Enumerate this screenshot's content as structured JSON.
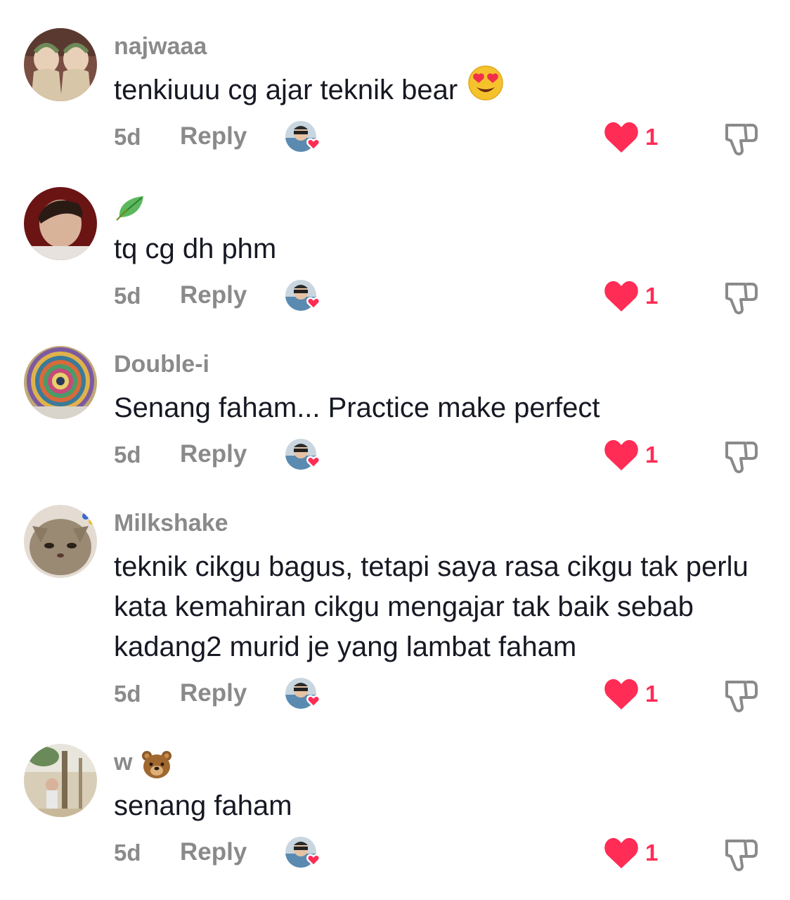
{
  "comments": [
    {
      "username": "najwaaa",
      "username_emoji": "",
      "text": "tenkiuuu cg ajar teknik bear",
      "text_emoji": "smiling-face-with-heart-eyes",
      "time": "5d",
      "reply_label": "Reply",
      "like_count": "1",
      "avatar_colors": [
        "#8b5a4a",
        "#e8d6c4"
      ]
    },
    {
      "username": "",
      "username_emoji": "🍃",
      "text": "tq cg dh phm",
      "text_emoji": "",
      "time": "5d",
      "reply_label": "Reply",
      "like_count": "1",
      "avatar_colors": [
        "#6b1414",
        "#d9b29a"
      ]
    },
    {
      "username": "Double-i",
      "username_emoji": "",
      "text": "Senang faham... Practice make perfect",
      "text_emoji": "",
      "time": "5d",
      "reply_label": "Reply",
      "like_count": "1",
      "avatar_colors": [
        "#5a6a7a",
        "#c8b070"
      ]
    },
    {
      "username": "Milkshake",
      "username_emoji": "",
      "text": "teknik cikgu bagus, tetapi saya rasa cikgu tak perlu kata kemahiran cikgu mengajar tak baik sebab kadang2 murid je yang lambat faham",
      "text_emoji": "",
      "time": "5d",
      "reply_label": "Reply",
      "like_count": "1",
      "avatar_colors": [
        "#8a7a66",
        "#d8cfc4"
      ]
    },
    {
      "username": "w",
      "username_emoji": "🐻",
      "text": "senang faham",
      "text_emoji": "",
      "time": "5d",
      "reply_label": "Reply",
      "like_count": "1",
      "avatar_colors": [
        "#c7b79c",
        "#6a8a5a"
      ]
    }
  ],
  "icons": {
    "like": "heart-icon",
    "dislike": "thumbs-down-icon",
    "creator_liked": "creator-liked-avatar-icon"
  },
  "colors": {
    "accent_like": "#ff2c55",
    "meta_gray": "#8a8a8a",
    "text": "#161823"
  }
}
